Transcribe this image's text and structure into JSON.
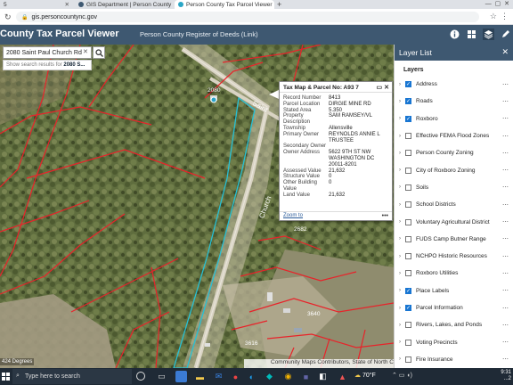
{
  "browser": {
    "tabs": [
      {
        "label": "5",
        "active": false
      },
      {
        "label": "GIS Department | Person County",
        "active": false
      },
      {
        "label": "Person County Tax Parcel Viewer",
        "active": true
      }
    ],
    "address": "gis.personcountync.gov"
  },
  "app": {
    "title": "County Tax Parcel Viewer",
    "register_link": "Person County Register of Deeds (Link)"
  },
  "search": {
    "value": "2080 Saint Paul Church Rd",
    "suggestion_prefix": "Show search results for",
    "suggestion_term": "2080 S..."
  },
  "map": {
    "labels": {
      "address_2080": "2080",
      "road_saint": "Saint",
      "road_church": "Church",
      "parcel_2682": "2682",
      "parcel_3640": "3640",
      "parcel_3616": "3616"
    },
    "scale": "424 Degrees",
    "attribution": "Community Maps Contributors, State of North Car..."
  },
  "popup": {
    "title": "Tax Map & Parcel No: A93 7",
    "fields": [
      {
        "label": "Record Number",
        "value": "8413"
      },
      {
        "label": "Parcel Location",
        "value": "DIRGIE MINE RD"
      },
      {
        "label": "Stated Area",
        "value": "5.350"
      },
      {
        "label": "Property Description",
        "value": "SAM RAMSEY/VL"
      },
      {
        "label": "Township",
        "value": "Allensville"
      },
      {
        "label": "Primary Owner",
        "value": "REYNOLDS ANNIE L TRUSTEE"
      },
      {
        "label": "Secondary Owner",
        "value": ""
      },
      {
        "label": "Owner Address",
        "value": "5622 9TH ST NW WASHINGTON DC 20011-8201"
      },
      {
        "label": "Assessed Value",
        "value": "21,632"
      },
      {
        "label": "Structure Value",
        "value": "0"
      },
      {
        "label": "Other Building Value",
        "value": "0"
      },
      {
        "label": "Land Value",
        "value": "21,632"
      }
    ],
    "zoom_link": "Zoom to",
    "more": "•••"
  },
  "layer_panel": {
    "title": "Layer List",
    "subtitle": "Layers",
    "layers": [
      {
        "name": "Address",
        "checked": true
      },
      {
        "name": "Roads",
        "checked": true
      },
      {
        "name": "Roxboro",
        "checked": true
      },
      {
        "name": "Effective FEMA Flood Zones",
        "checked": false
      },
      {
        "name": "Person County Zoning",
        "checked": false
      },
      {
        "name": "City of Roxboro Zoning",
        "checked": false
      },
      {
        "name": "Soils",
        "checked": false
      },
      {
        "name": "School Districts",
        "checked": false
      },
      {
        "name": "Voluntary Agricultural District",
        "checked": false
      },
      {
        "name": "FUDS Camp Butner Range",
        "checked": false
      },
      {
        "name": "NCHPO Historic Resources",
        "checked": false
      },
      {
        "name": "Roxboro Utilities",
        "checked": false
      },
      {
        "name": "Place Labels",
        "checked": true
      },
      {
        "name": "Parcel Information",
        "checked": true
      },
      {
        "name": "Rivers, Lakes, and Ponds",
        "checked": false
      },
      {
        "name": "Voting Precincts",
        "checked": false
      },
      {
        "name": "Fire Insurance",
        "checked": false
      }
    ]
  },
  "taskbar": {
    "search_placeholder": "Type here to search",
    "weather": "70°F",
    "time": "9:31",
    "date": "...2"
  },
  "colors": {
    "header": "#3e5871",
    "parcel_line": "#e8232a",
    "selected_parcel": "#27c1d6",
    "checkbox": "#1976d2"
  }
}
